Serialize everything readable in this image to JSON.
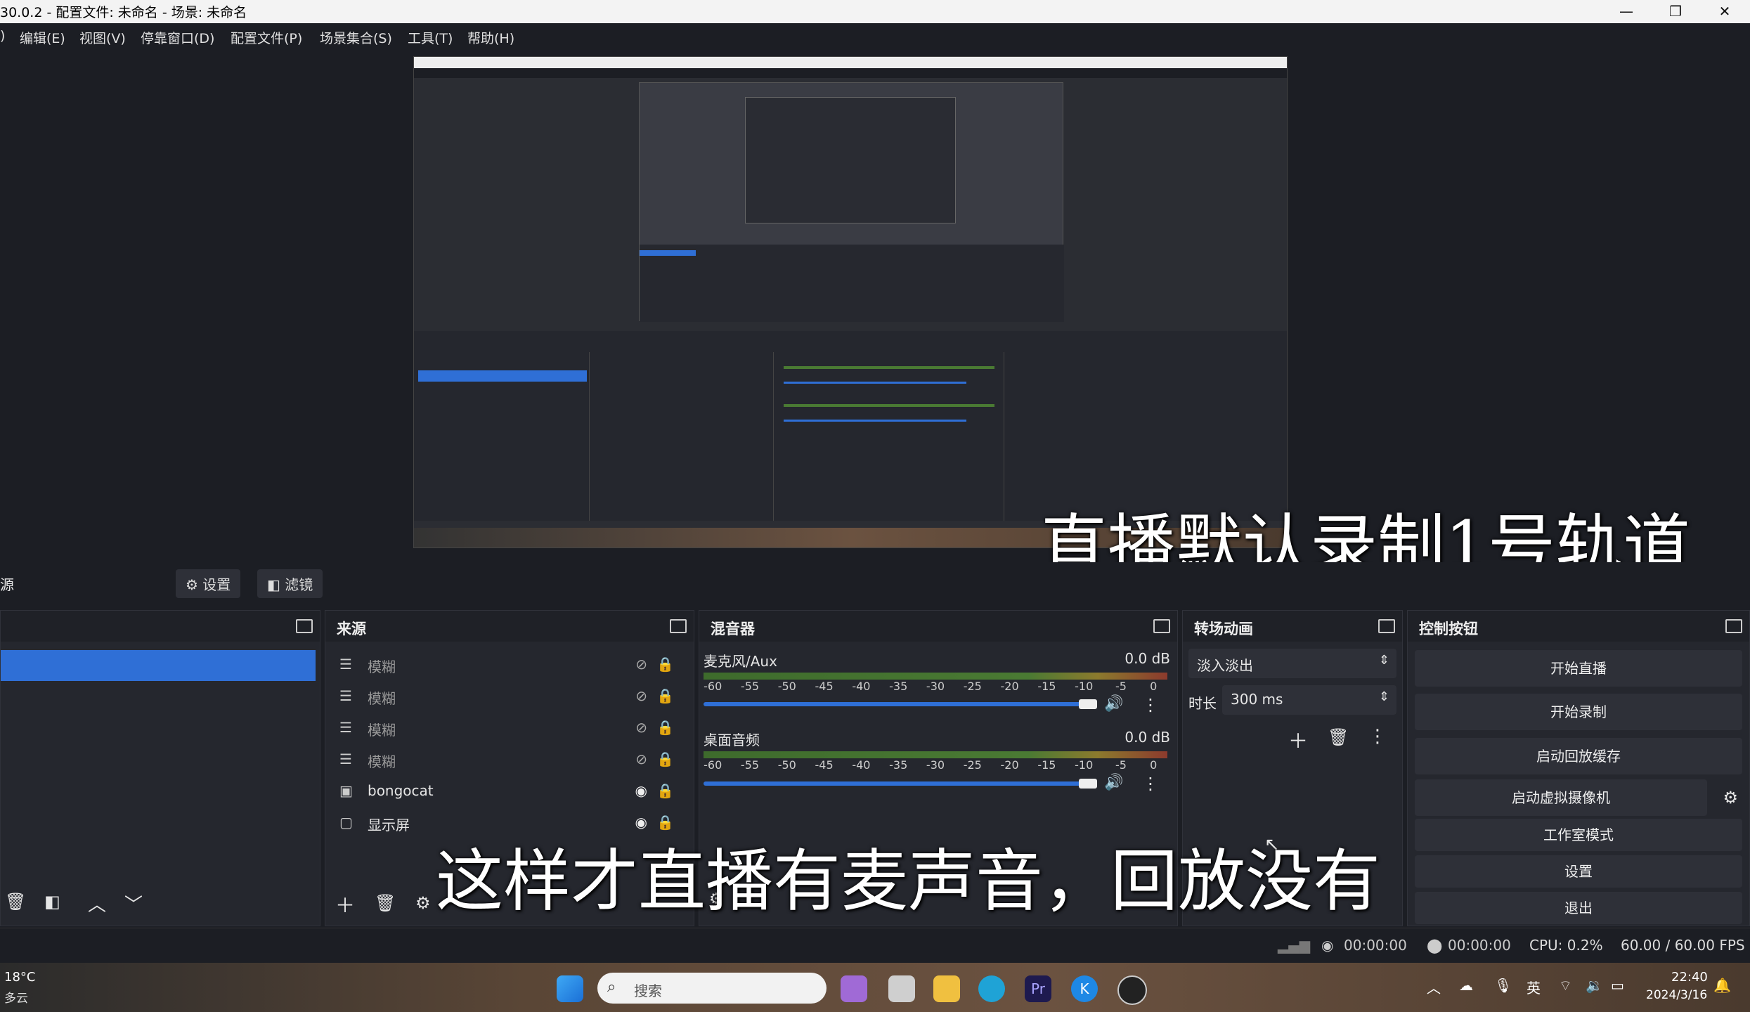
{
  "window": {
    "title": "30.0.2 - 配置文件: 未命名 - 场景: 未命名",
    "controls": [
      "—",
      "❐",
      "✕"
    ]
  },
  "menu": [
    "编辑(E)",
    "视图(V)",
    "停靠窗口(D)",
    "配置文件(P)",
    "场景集合(S)",
    "工具(T)",
    "帮助(H)"
  ],
  "sourcebar": {
    "left_label": "源",
    "settings": "设置",
    "filters": "滤镜"
  },
  "docks": {
    "scenes": {
      "title": ""
    },
    "sources": {
      "title": "来源",
      "items": [
        {
          "name": "模糊",
          "visible": false
        },
        {
          "name": "模糊",
          "visible": false
        },
        {
          "name": "模糊",
          "visible": false
        },
        {
          "name": "模糊",
          "visible": false
        },
        {
          "name": "bongocat",
          "visible": true
        },
        {
          "name": "显示屏",
          "visible": true
        }
      ]
    },
    "mixer": {
      "title": "混音器",
      "tracks": [
        {
          "name": "麦克风/Aux",
          "db": "0.0 dB"
        },
        {
          "name": "桌面音频",
          "db": "0.0 dB"
        }
      ],
      "scale": [
        "-60",
        "-55",
        "-50",
        "-45",
        "-40",
        "-35",
        "-30",
        "-25",
        "-20",
        "-15",
        "-10",
        "-5",
        "0"
      ]
    },
    "transitions": {
      "title": "转场动画",
      "selected": "淡入淡出",
      "duration_label": "时长",
      "duration_value": "300 ms"
    },
    "controls": {
      "title": "控制按钮",
      "buttons": [
        "开始直播",
        "开始录制",
        "启动回放缓存",
        "启动虚拟摄像机",
        "工作室模式",
        "设置",
        "退出"
      ]
    }
  },
  "status": {
    "stream_time": "00:00:00",
    "record_time": "00:00:00",
    "cpu": "CPU: 0.2%",
    "fps": "60.00 / 60.00 FPS"
  },
  "taskbar": {
    "weather_temp": "18°C",
    "weather_desc": "多云",
    "search_placeholder": "搜索",
    "ime": "英",
    "time": "22:40",
    "date": "2024/3/16"
  },
  "subtitles": {
    "line1": "直播默认录制1号轨道",
    "line2": "这样才直播有麦声音，回放没有"
  },
  "colors": {
    "accent": "#2f6fd6",
    "panel": "#25272e",
    "bg": "#1c1e24"
  }
}
